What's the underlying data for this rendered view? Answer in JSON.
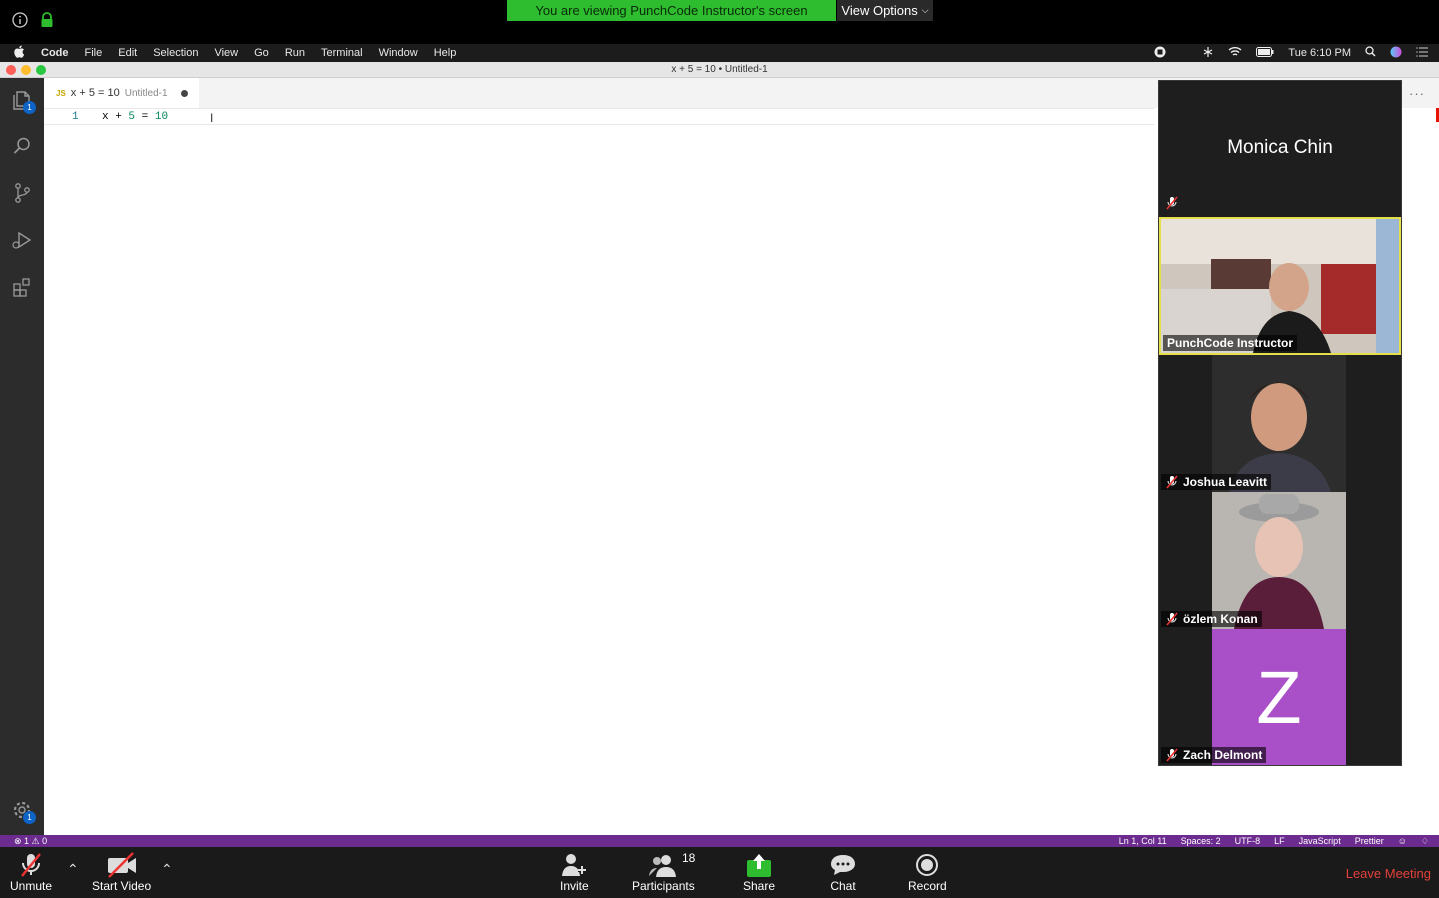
{
  "zoom_top": {
    "banner": "You are viewing PunchCode Instructor's screen",
    "view_options": "View Options"
  },
  "menubar": {
    "app": "Code",
    "items": [
      "File",
      "Edit",
      "Selection",
      "View",
      "Go",
      "Run",
      "Terminal",
      "Window",
      "Help"
    ],
    "clock": "Tue 6:10 PM"
  },
  "window": {
    "title": "x + 5 = 10 • Untitled-1"
  },
  "activity_badges": {
    "explorer": "1",
    "settings": "1"
  },
  "editor": {
    "tab": {
      "lang_badge": "JS",
      "name": "x + 5 = 10",
      "description": "Untitled-1"
    },
    "line_number": "1",
    "code": {
      "var": "x",
      "op1": " + ",
      "num1": "5",
      "op2": " = ",
      "num2": "10"
    },
    "more": "···"
  },
  "statusbar": {
    "problems": "⊗ 1 ⚠ 0",
    "position": "Ln 1, Col 11",
    "spaces": "Spaces: 2",
    "encoding": "UTF-8",
    "eol": "LF",
    "language": "JavaScript",
    "formatter": "Prettier"
  },
  "participants": [
    {
      "name": "Monica Chin",
      "muted": true,
      "video": false
    },
    {
      "name": "PunchCode Instructor",
      "muted": false,
      "video": true,
      "active_speaker": true
    },
    {
      "name": "Joshua Leavitt",
      "muted": true,
      "video": true
    },
    {
      "name": "özlem Konan",
      "muted": true,
      "video": true
    },
    {
      "name": "Zach Delmont",
      "muted": true,
      "video": false,
      "initial": "Z",
      "avatar_color": "#a94fc7"
    }
  ],
  "zoom_bottom": {
    "unmute": "Unmute",
    "start_video": "Start Video",
    "invite": "Invite",
    "participants": "Participants",
    "participant_count": "18",
    "share": "Share",
    "chat": "Chat",
    "record": "Record",
    "leave": "Leave Meeting"
  },
  "colors": {
    "banner_green": "#2ebd2e",
    "status_purple": "#6c2b8f",
    "active_speaker": "#e3e04a",
    "leave_red": "#e5403a"
  }
}
